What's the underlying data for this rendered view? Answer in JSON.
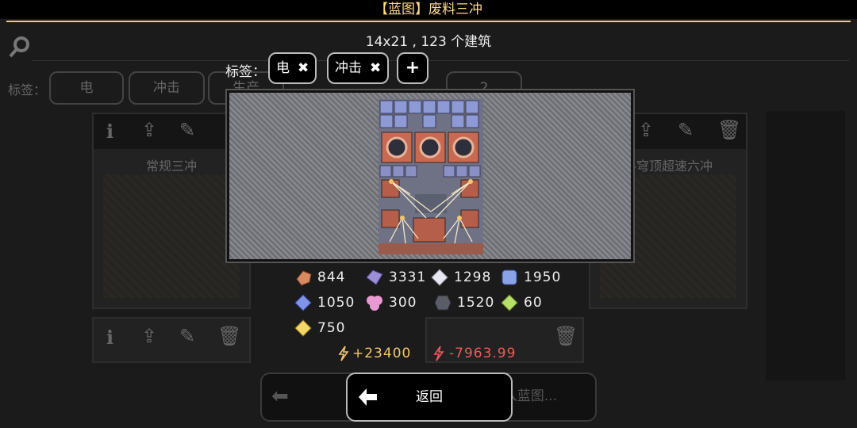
{
  "header": {
    "title": "【蓝图】废料三冲"
  },
  "background": {
    "tag_label": "标签：",
    "tags": [
      "电",
      "冲击",
      "生产",
      "",
      "",
      "2"
    ],
    "cards": [
      {
        "title": "常规三冲"
      },
      {
        "title": "料穹顶超速六冲"
      }
    ],
    "bottom_right_text": "入蓝图..."
  },
  "dialog": {
    "summary": "14x21 , 123 个建筑",
    "tag_label": "标签：",
    "tags": [
      {
        "label": "电",
        "remove": "✖"
      },
      {
        "label": "冲击",
        "remove": "✖"
      }
    ],
    "add_tag": "+",
    "resources": [
      {
        "name": "copper",
        "value": "844",
        "color": "#d98a5e"
      },
      {
        "name": "lead",
        "value": "3331",
        "color": "#9d8fd6"
      },
      {
        "name": "metaglass",
        "value": "1298",
        "color": "#e8e8f0"
      },
      {
        "name": "titanium",
        "value": "1950",
        "color": "#8aa2e6"
      },
      {
        "name": "plastanium",
        "value": "1050",
        "color": "#7f93e8"
      },
      {
        "name": "phase-fabric",
        "value": "300",
        "color": "#e89ad2"
      },
      {
        "name": "silicon",
        "value": "1520",
        "color": "#5a5d66"
      },
      {
        "name": "thorium",
        "value": "60",
        "color": "#b6e06a"
      },
      {
        "name": "surge-alloy",
        "value": "750",
        "color": "#f2d66a"
      }
    ],
    "power_gen": "+23400",
    "power_use": "-7963.99",
    "colors": {
      "power_gen": "#f2c66a",
      "power_use": "#ee5a5a",
      "accent": "#e9c98e"
    },
    "back_label": "返回"
  }
}
